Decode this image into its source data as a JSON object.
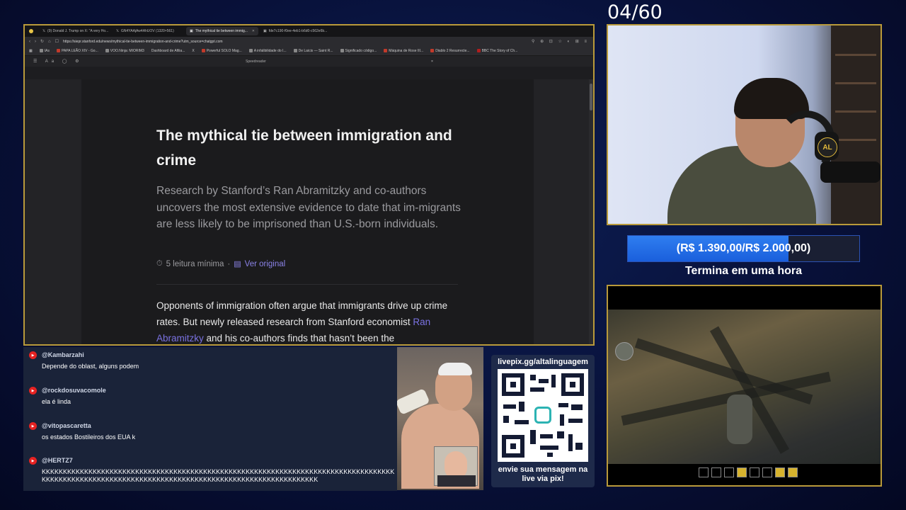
{
  "overlay": {
    "counter": "04/60",
    "goal": {
      "text": "(R$ 1.390,00/R$ 2.000,00)",
      "progress": 0.695,
      "subtitle": "Termina em uma hora"
    },
    "qr": {
      "top": "livepix.gg/altalinguagem",
      "bottom_line1": "envie sua mensagem na",
      "bottom_line2": "live via pix!"
    },
    "webcam_badge": "AL"
  },
  "browser": {
    "tabs": [
      {
        "label": "(9) Donald J. Trump on X: \"A very Ho...",
        "active": false
      },
      {
        "label": "GN4YAAjAw4AhUOV (1320×561)",
        "active": false
      },
      {
        "label": "The mythical tie between immig...",
        "active": true
      },
      {
        "label": "fde7c190-f0ee-4eb1-b6d0-c562e6b...",
        "active": false
      }
    ],
    "url": "https://siepr.stanford.edu/news/mythical-tie-between-immigration-and-crime?utm_source=chatgpt.com",
    "bookmarks": [
      "IAs",
      "PAPA LEÃO XIV - Go...",
      "VOO.Ninja: MIORIM3",
      "Dashboard de Afilia...",
      "X",
      "Powerful SOLO Mag...",
      "A infalibilidade do I...",
      "De Laicis — Saint R...",
      "Significado código...",
      "Máquina de Rose III...",
      "Diablo 2 Resurrecte...",
      "BBC The Story of Ch..."
    ],
    "reader_title": "Speedreader",
    "reader_close": "×"
  },
  "article": {
    "title": "The mythical tie between immigration and crime",
    "subtitle": "Research by Stanford’s Ran Abramitzky and co-authors uncovers the most extensive evidence to date that im-migrants are less likely to be imprisoned than U.S.-born individuals.",
    "read_time": "5 leitura mínima",
    "separator": "·",
    "view_original": "Ver original",
    "body_pre": "Opponents of immigration often argue that immigrants drive up crime rates. But newly released research from Stanford economist ",
    "body_link": "Ran Abramitzky",
    "body_post": " and his co-authors finds that hasn’t been the"
  },
  "chat": {
    "messages": [
      {
        "user": "@Kambarzahi",
        "text": "Depende do oblast, alguns podem"
      },
      {
        "user": "@rockdosuvacomole",
        "text": "ela é linda"
      },
      {
        "user": "@vitopascaretta",
        "text": "os estados Bostileiros dos EUA k"
      },
      {
        "user": "@HERTZ7",
        "text": "KKKKKKKKKKKKKKKKKKKKKKKKKKKKKKKKKKKKKKKKKKKKKKKKKKKKKKKKKKKKKKKKKKKKKKKKKKKKKKKKKKKKKKKKKKKKKKKKKKKKKKKKKKKKKKKKKKKKKKKKKKKKKKKKKKKKKKKKKKKKKKKKKKKK"
      }
    ]
  },
  "colors": {
    "frame_gold": "#b99a3a",
    "goal_fill": "#2f7ef0",
    "link_purple": "#8b83e8",
    "youtube_red": "#e52222"
  }
}
